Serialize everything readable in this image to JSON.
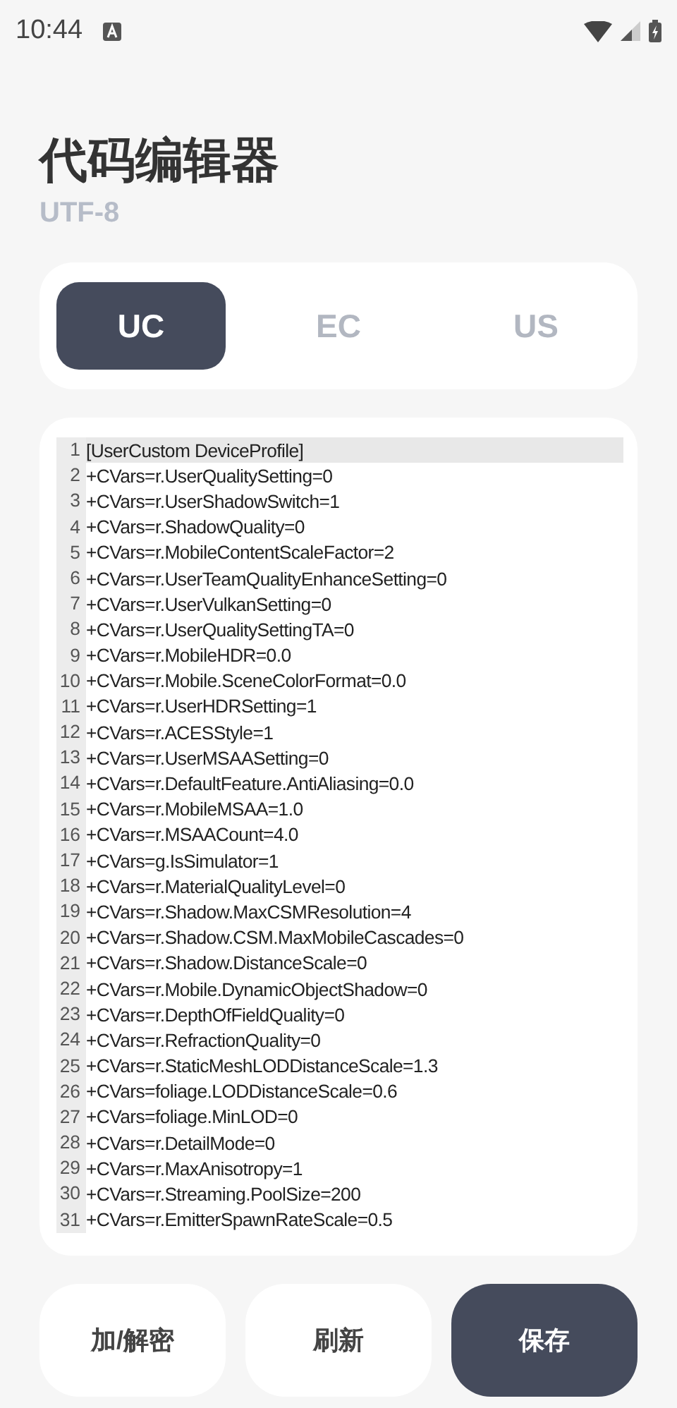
{
  "status_bar": {
    "time": "10:44"
  },
  "title": "代码编辑器",
  "subtitle": "UTF-8",
  "tabs": [
    {
      "label": "UC",
      "selected": true
    },
    {
      "label": "EC",
      "selected": false
    },
    {
      "label": "US",
      "selected": false
    }
  ],
  "editor": {
    "lines": [
      {
        "number": "1",
        "text": "[UserCustom DeviceProfile]",
        "highlighted": true
      },
      {
        "number": "2",
        "text": "+CVars=r.UserQualitySetting=0",
        "highlighted": false
      },
      {
        "number": "3",
        "text": "+CVars=r.UserShadowSwitch=1",
        "highlighted": false
      },
      {
        "number": "4",
        "text": "+CVars=r.ShadowQuality=0",
        "highlighted": false
      },
      {
        "number": "5",
        "text": "+CVars=r.MobileContentScaleFactor=2",
        "highlighted": false
      },
      {
        "number": "6",
        "text": "+CVars=r.UserTeamQualityEnhanceSetting=0",
        "highlighted": false
      },
      {
        "number": "7",
        "text": "+CVars=r.UserVulkanSetting=0",
        "highlighted": false
      },
      {
        "number": "8",
        "text": "+CVars=r.UserQualitySettingTA=0",
        "highlighted": false
      },
      {
        "number": "9",
        "text": "+CVars=r.MobileHDR=0.0",
        "highlighted": false
      },
      {
        "number": "10",
        "text": "+CVars=r.Mobile.SceneColorFormat=0.0",
        "highlighted": false
      },
      {
        "number": "11",
        "text": "+CVars=r.UserHDRSetting=1",
        "highlighted": false
      },
      {
        "number": "12",
        "text": "+CVars=r.ACESStyle=1",
        "highlighted": false
      },
      {
        "number": "13",
        "text": "+CVars=r.UserMSAASetting=0",
        "highlighted": false
      },
      {
        "number": "14",
        "text": "+CVars=r.DefaultFeature.AntiAliasing=0.0",
        "highlighted": false
      },
      {
        "number": "15",
        "text": "+CVars=r.MobileMSAA=1.0",
        "highlighted": false
      },
      {
        "number": "16",
        "text": "+CVars=r.MSAACount=4.0",
        "highlighted": false
      },
      {
        "number": "17",
        "text": "+CVars=g.IsSimulator=1",
        "highlighted": false
      },
      {
        "number": "18",
        "text": "+CVars=r.MaterialQualityLevel=0",
        "highlighted": false
      },
      {
        "number": "19",
        "text": "+CVars=r.Shadow.MaxCSMResolution=4",
        "highlighted": false
      },
      {
        "number": "20",
        "text": "+CVars=r.Shadow.CSM.MaxMobileCascades=0",
        "highlighted": false
      },
      {
        "number": "21",
        "text": "+CVars=r.Shadow.DistanceScale=0",
        "highlighted": false
      },
      {
        "number": "22",
        "text": "+CVars=r.Mobile.DynamicObjectShadow=0",
        "highlighted": false
      },
      {
        "number": "23",
        "text": "+CVars=r.DepthOfFieldQuality=0",
        "highlighted": false
      },
      {
        "number": "24",
        "text": "+CVars=r.RefractionQuality=0",
        "highlighted": false
      },
      {
        "number": "25",
        "text": "+CVars=r.StaticMeshLODDistanceScale=1.3",
        "highlighted": false
      },
      {
        "number": "26",
        "text": "+CVars=foliage.LODDistanceScale=0.6",
        "highlighted": false
      },
      {
        "number": "27",
        "text": "+CVars=foliage.MinLOD=0",
        "highlighted": false
      },
      {
        "number": "28",
        "text": "+CVars=r.DetailMode=0",
        "highlighted": false
      },
      {
        "number": "29",
        "text": "+CVars=r.MaxAnisotropy=1",
        "highlighted": false
      },
      {
        "number": "30",
        "text": "+CVars=r.Streaming.PoolSize=200",
        "highlighted": false
      },
      {
        "number": "31",
        "text": "+CVars=r.EmitterSpawnRateScale=0.5",
        "highlighted": false
      }
    ]
  },
  "buttons": [
    {
      "label": "加/解密",
      "kind": "secondary"
    },
    {
      "label": "刷新",
      "kind": "secondary"
    },
    {
      "label": "保存",
      "kind": "primary"
    }
  ]
}
